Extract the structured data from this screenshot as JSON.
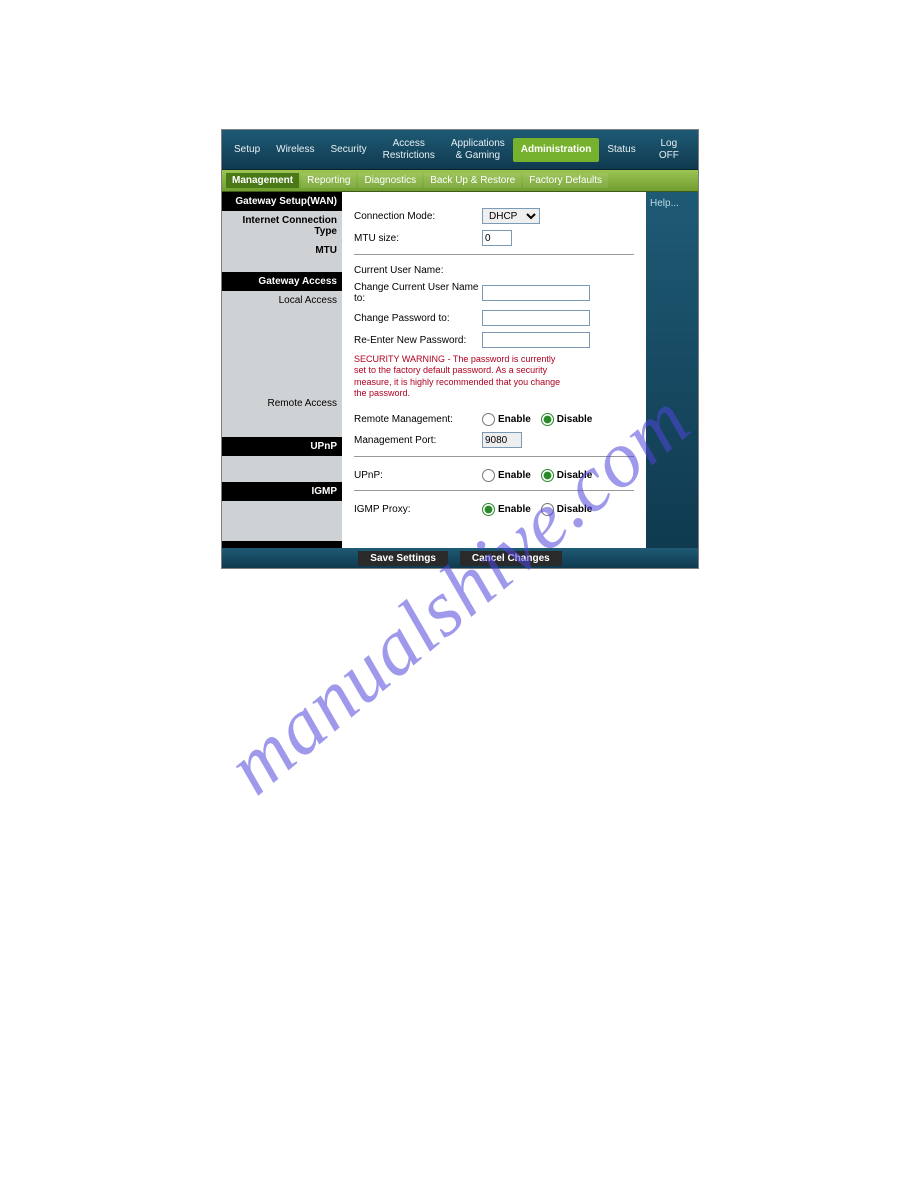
{
  "watermark": "manualshive.com",
  "topnav": {
    "items": [
      {
        "label": "Setup"
      },
      {
        "label": "Wireless"
      },
      {
        "label": "Security"
      },
      {
        "label": "Access\nRestrictions"
      },
      {
        "label": "Applications\n& Gaming"
      },
      {
        "label": "Administration",
        "active": true
      },
      {
        "label": "Status"
      },
      {
        "label": "Log OFF"
      }
    ]
  },
  "subnav": {
    "items": [
      {
        "label": "Management",
        "active": true
      },
      {
        "label": "Reporting"
      },
      {
        "label": "Diagnostics"
      },
      {
        "label": "Back Up & Restore"
      },
      {
        "label": "Factory Defaults"
      }
    ]
  },
  "sidebar": {
    "gateway_setup_heading": "Gateway Setup(WAN)",
    "internet_connection_type": "Internet Connection Type",
    "mtu": "MTU",
    "gateway_access_heading": "Gateway Access",
    "local_access": "Local Access",
    "remote_access": "Remote Access",
    "upnp_heading": "UPnP",
    "igmp_heading": "IGMP"
  },
  "form": {
    "connection_mode_label": "Connection Mode:",
    "connection_mode_value": "DHCP",
    "mtu_size_label": "MTU size:",
    "mtu_size_value": "0",
    "current_user_label": "Current User Name:",
    "change_user_label": "Change Current User Name to:",
    "change_user_value": "",
    "change_password_label": "Change Password to:",
    "change_password_value": "",
    "reenter_password_label": "Re-Enter New Password:",
    "reenter_password_value": "",
    "security_warning": "SECURITY WARNING - The password is currently set to the factory default password. As a security measure, it is highly recommended that you change the password.",
    "remote_mgmt_label": "Remote Management:",
    "mgmt_port_label": "Management Port:",
    "mgmt_port_value": "9080",
    "upnp_label": "UPnP:",
    "igmp_label": "IGMP Proxy:",
    "enable": "Enable",
    "disable": "Disable"
  },
  "help": {
    "title": "Help..."
  },
  "footer": {
    "save": "Save Settings",
    "cancel": "Cancel Changes"
  }
}
